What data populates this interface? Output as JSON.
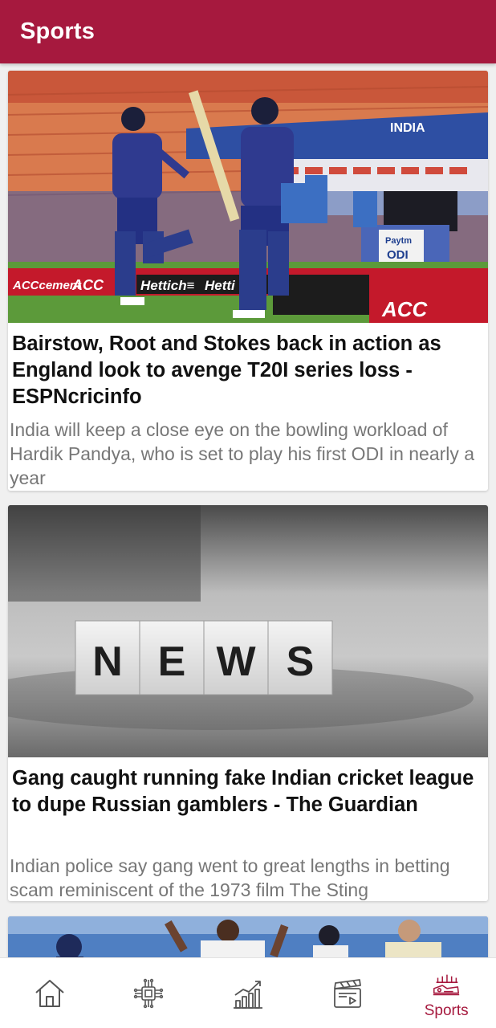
{
  "appbar": {
    "title": "Sports",
    "color": "#a6193e"
  },
  "articles": [
    {
      "title": "Bairstow, Root and Stokes back in action as England look to avenge T20I series loss - ESPNcricinfo",
      "description": "India will keep a close eye on the bowling workload of Hardik Pandya, who is set to play his first ODI in nearly a year",
      "image": "cricket-players-walking-out-photo",
      "image_text": [
        "INDIA",
        "ACC",
        "Hettich",
        "Paytm ODI"
      ]
    },
    {
      "title": "Gang caught running fake Indian cricket league to dupe Russian gamblers - The Guardian",
      "description": "Indian police say gang went to great lengths in betting scam reminiscent of the 1973 film The Sting",
      "image": "news-letter-blocks-photo",
      "image_text": [
        "N",
        "E",
        "W",
        "S"
      ]
    },
    {
      "image": "cricket-team-celebration-photo"
    }
  ],
  "bottom_nav": {
    "items": [
      {
        "icon": "home-icon"
      },
      {
        "icon": "technology-chip-icon"
      },
      {
        "icon": "business-chart-icon"
      },
      {
        "icon": "entertainment-clapperboard-icon"
      },
      {
        "icon": "sports-icon",
        "label": "Sports",
        "active": true
      }
    ]
  }
}
